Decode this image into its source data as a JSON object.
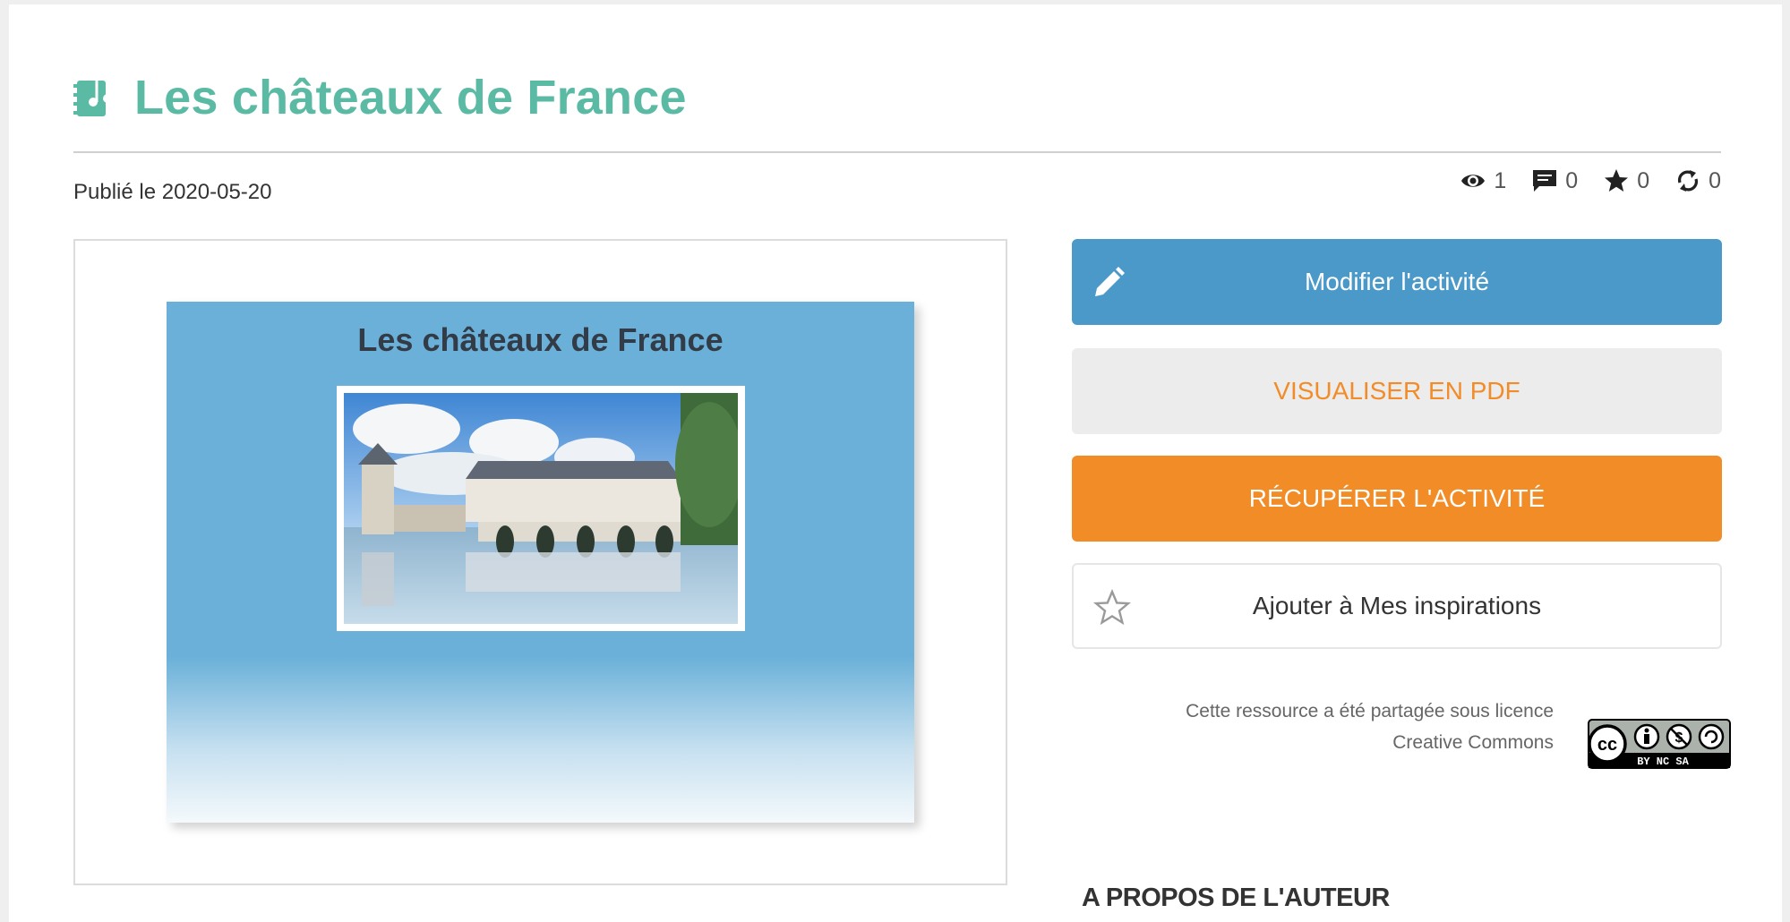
{
  "page": {
    "title": "Les châteaux de France",
    "published": "Publié le 2020-05-20"
  },
  "stats": {
    "views": "1",
    "comments": "0",
    "favorites": "0",
    "shares": "0"
  },
  "preview": {
    "slide_title": "Les châteaux de France"
  },
  "actions": {
    "edit_label": "Modifier l'activité",
    "pdf_label": "VISUALISER EN PDF",
    "get_label": "RÉCUPÉRER L'ACTIVITÉ",
    "inspirations_label": "Ajouter à Mes inspirations"
  },
  "license": {
    "text": "Cette ressource a été partagée sous licence Creative Commons",
    "badge_text": "BY NC SA"
  },
  "about": {
    "heading": "A PROPOS DE L'AUTEUR"
  },
  "colors": {
    "title": "#5bbaa4",
    "edit_button": "#4a99c9",
    "orange": "#f28c26",
    "slide_bg": "#6ab0d8"
  },
  "icons": {
    "title": "music-book-icon",
    "views": "eye-icon",
    "comments": "comment-icon",
    "favorites": "star-icon",
    "shares": "sync-icon",
    "edit": "pencil-icon",
    "inspirations": "star-outline-icon"
  }
}
